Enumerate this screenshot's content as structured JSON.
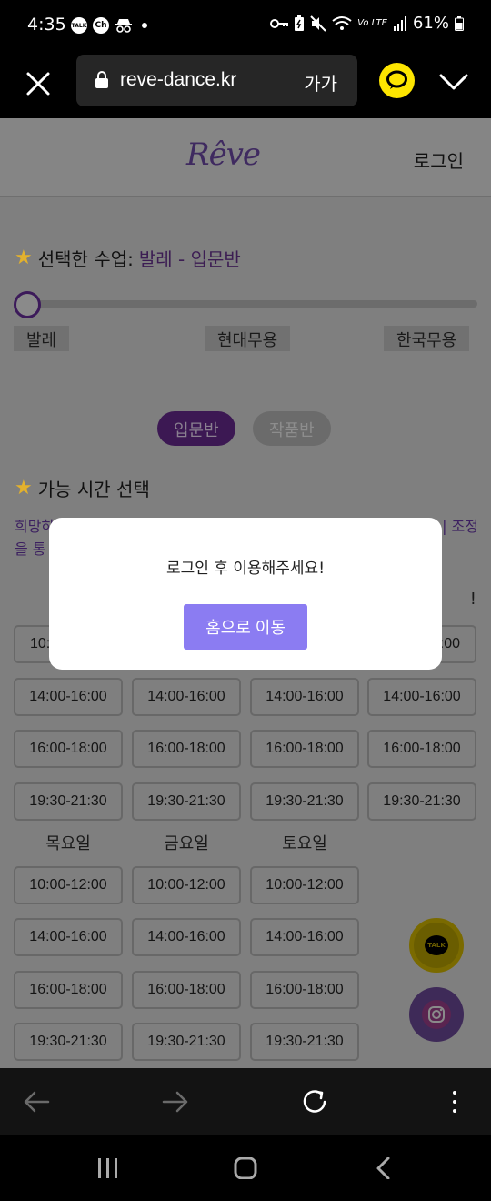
{
  "status": {
    "time": "4:35",
    "left_icons": [
      "TALK",
      "Ch"
    ],
    "battery": "61%"
  },
  "browser": {
    "url": "reve-dance.kr",
    "text_size_label": "가가"
  },
  "site": {
    "logo": "Rêve",
    "login": "로그인"
  },
  "selection": {
    "prefix": "선택한 수업:",
    "value": "발레 - 입문반",
    "slider_labels": [
      "발레",
      "현대무용",
      "한국무용"
    ],
    "slider_position": 0
  },
  "levels": {
    "active": "입문반",
    "inactive": "작품반"
  },
  "time_section": {
    "title": "가능 시간 선택",
    "notice": "희망하",
    "notice_end": "| 조정",
    "notice_line2": "을 통",
    "top_day_marks": [
      "·",
      "!"
    ],
    "first_row_first": "10:",
    "first_row_last": ":00",
    "rows_week1": [
      [
        "14:00-16:00",
        "14:00-16:00",
        "14:00-16:00",
        "14:00-16:00"
      ],
      [
        "16:00-18:00",
        "16:00-18:00",
        "16:00-18:00",
        "16:00-18:00"
      ],
      [
        "19:30-21:30",
        "19:30-21:30",
        "19:30-21:30",
        "19:30-21:30"
      ]
    ],
    "days_week2": [
      "목요일",
      "금요일",
      "토요일"
    ],
    "rows_week2": [
      [
        "10:00-12:00",
        "10:00-12:00",
        "10:00-12:00"
      ],
      [
        "14:00-16:00",
        "14:00-16:00",
        "14:00-16:00"
      ],
      [
        "16:00-18:00",
        "16:00-18:00",
        "16:00-18:00"
      ],
      [
        "19:30-21:30",
        "19:30-21:30",
        "19:30-21:30"
      ]
    ]
  },
  "floating": {
    "kakao_label": "TALK"
  },
  "modal": {
    "message": "로그인 후 이용해주세요!",
    "button": "홈으로 이동"
  },
  "colors": {
    "accent": "#8b7cf2",
    "brand_purple": "#6a2e91",
    "kakao_yellow": "#fde500"
  }
}
